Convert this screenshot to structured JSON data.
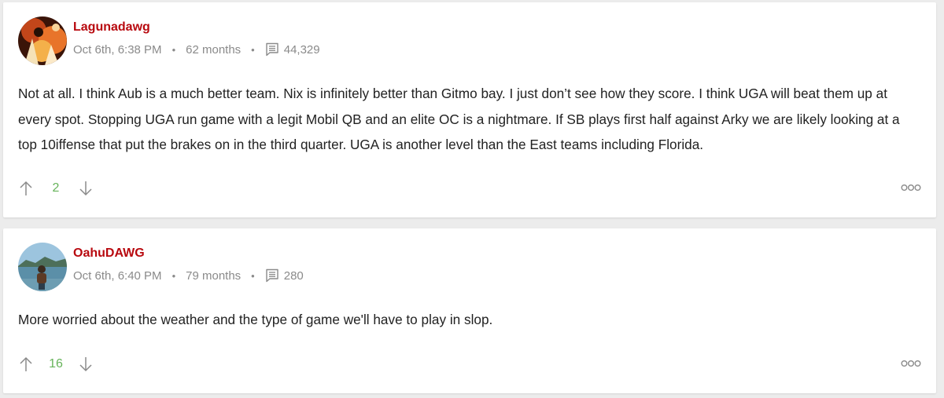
{
  "posts": [
    {
      "username": "Lagunadawg",
      "timestamp": "Oct 6th, 6:38 PM",
      "tenure": "62 months",
      "post_count": "44,329",
      "body": "Not at all. I think Aub is a much better team. Nix is infinitely better than Gitmo bay. I just don’t see how they score. I think UGA will beat them up at every spot. Stopping UGA run game with a legit Mobil QB and an elite OC is a nightmare. If SB plays first half against Arky we are likely looking at a top 10iffense that put the brakes on in the third quarter. UGA is another level than the East teams including Florida.",
      "score": "2",
      "avatar_icon": "user-avatar-image"
    },
    {
      "username": "OahuDAWG",
      "timestamp": "Oct 6th, 6:40 PM",
      "tenure": "79 months",
      "post_count": "280",
      "body": "More worried about the weather and the type of game we'll have to play in slop.",
      "score": "16",
      "avatar_icon": "user-avatar-image"
    }
  ],
  "separator": "•",
  "colors": {
    "username": "#b8090f",
    "meta": "#8a8a8a",
    "score": "#66b35a",
    "page_bg": "#ececec",
    "card_bg": "#ffffff"
  },
  "icons": {
    "upvote": "arrow-up-icon",
    "downvote": "arrow-down-icon",
    "post_count": "comment-icon",
    "more": "more-options-icon"
  }
}
